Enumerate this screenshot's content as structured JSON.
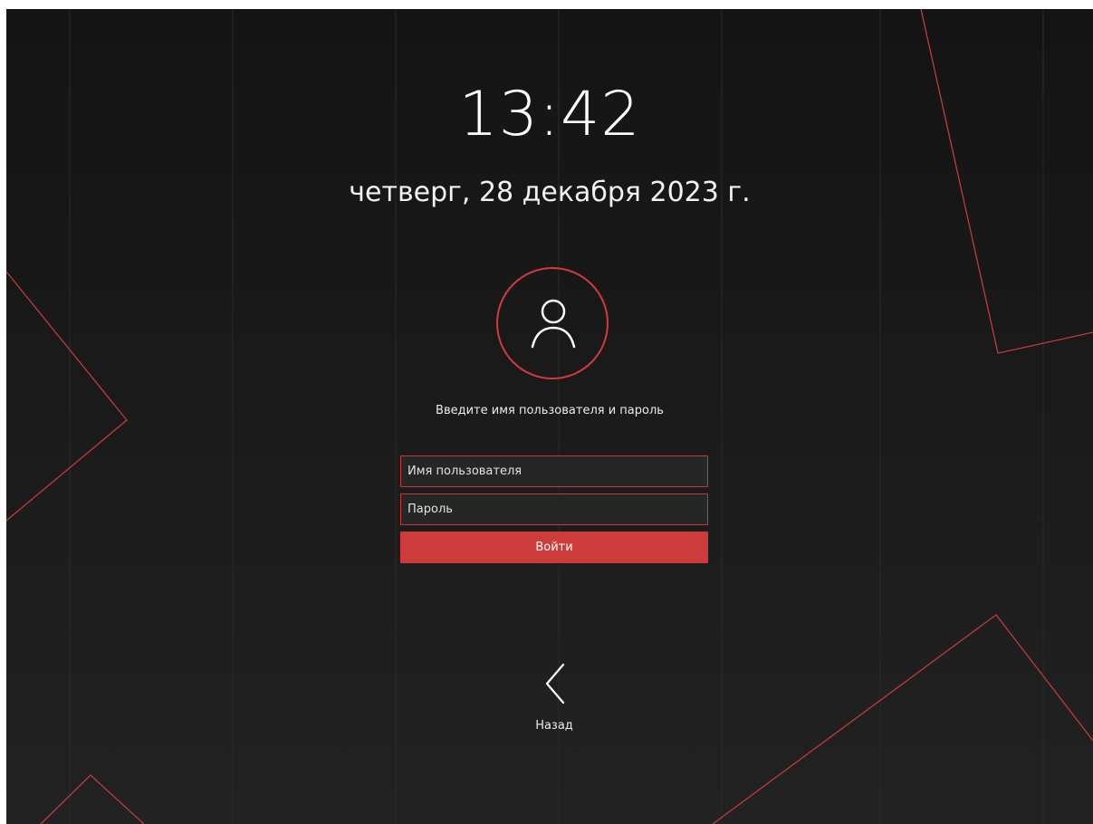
{
  "lockscreen": {
    "time": "13:42",
    "date": "четверг, 28 декабря 2023 г."
  },
  "login": {
    "prompt": "Введите имя пользователя и пароль",
    "username_placeholder": "Имя пользователя",
    "username_value": "",
    "password_placeholder": "Пароль",
    "password_value": "",
    "submit_label": "Войти"
  },
  "navigation": {
    "back_label": "Назад"
  },
  "icons": {
    "avatar": "user-icon",
    "back": "chevron-left-icon"
  },
  "colors": {
    "accent": "#cd3b3b",
    "background": "#1a1a1a",
    "text": "#ffffff"
  }
}
